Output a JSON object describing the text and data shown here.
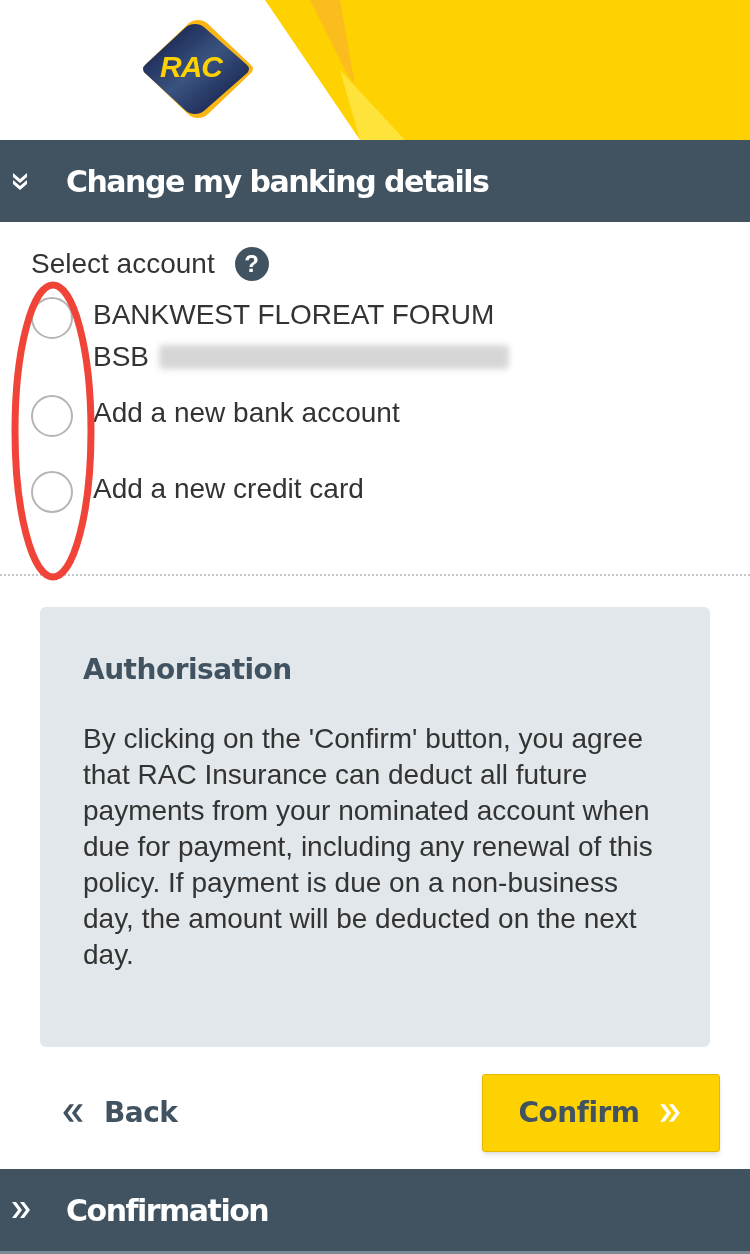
{
  "header": {
    "logo_text": "RAC"
  },
  "section": {
    "title": "Change my banking details",
    "expanded": true
  },
  "select_account": {
    "label": "Select account",
    "help": "?",
    "options": [
      {
        "label": "BANKWEST FLOREAT FORUM",
        "detail_label": "BSB",
        "detail_redacted": true,
        "selected": false
      },
      {
        "label": "Add a new bank account",
        "selected": false
      },
      {
        "label": "Add a new credit card",
        "selected": false
      }
    ]
  },
  "authorisation": {
    "title": "Authorisation",
    "text": "By clicking on the 'Confirm' button, you agree that RAC Insurance can deduct all future payments from your nominated account when due for payment, including any renewal of this policy. If payment is due on a non-business day, the amount will be deducted on the next day."
  },
  "buttons": {
    "back": "Back",
    "confirm": "Confirm"
  },
  "next_section": {
    "title": "Confirmation",
    "expanded": false
  },
  "annotation": {
    "kind": "ellipse",
    "color": "#f04438"
  }
}
